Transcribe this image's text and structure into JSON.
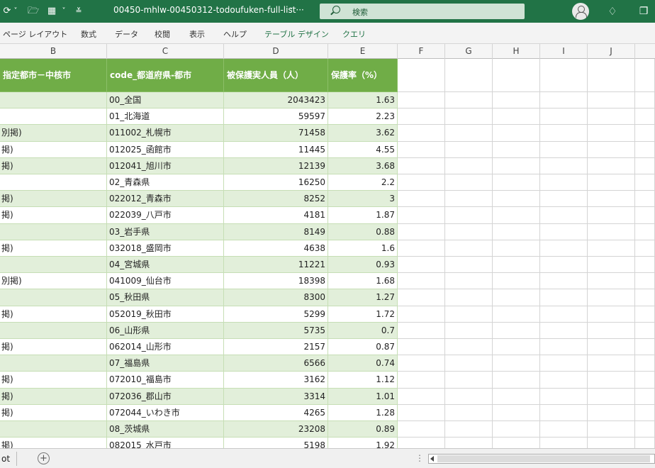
{
  "titlebar": {
    "refresh_glyph": "⟳",
    "refresh_chevron": "˅",
    "folder_glyph": "🗁",
    "form_glyph": "▦",
    "form_chevron": "˅",
    "qa_glyph": "≚",
    "document_title": "00450-mhlw-00450312-todoufuken-full-list···",
    "title_chevron": "˅",
    "search_placeholder": "検索",
    "premium_glyph": "♢",
    "restore_glyph": "❐"
  },
  "ribbon": {
    "tabs": [
      "ページ レイアウト",
      "数式",
      "データ",
      "校閲",
      "表示",
      "ヘルプ",
      "テーブル デザイン",
      "クエリ"
    ]
  },
  "column_headers": [
    "B",
    "C",
    "D",
    "E",
    "F",
    "G",
    "H",
    "I",
    "J"
  ],
  "table": {
    "headers": [
      "指定都市－中核市",
      "code_都道府県-都市",
      "被保護実人員（人）",
      "保護率（%）"
    ],
    "rows": [
      {
        "b": "",
        "c": "00_全国",
        "d": "2043423",
        "e": "1.63"
      },
      {
        "b": "",
        "c": "01_北海道",
        "d": "59597",
        "e": "2.23"
      },
      {
        "b": "別掲)",
        "c": "011002_札幌市",
        "d": "71458",
        "e": "3.62"
      },
      {
        "b": "掲)",
        "c": "012025_函館市",
        "d": "11445",
        "e": "4.55"
      },
      {
        "b": "掲)",
        "c": "012041_旭川市",
        "d": "12139",
        "e": "3.68"
      },
      {
        "b": "",
        "c": "02_青森県",
        "d": "16250",
        "e": "2.2"
      },
      {
        "b": "掲)",
        "c": "022012_青森市",
        "d": "8252",
        "e": "3"
      },
      {
        "b": "掲)",
        "c": "022039_八戸市",
        "d": "4181",
        "e": "1.87"
      },
      {
        "b": "",
        "c": "03_岩手県",
        "d": "8149",
        "e": "0.88"
      },
      {
        "b": "掲)",
        "c": "032018_盛岡市",
        "d": "4638",
        "e": "1.6"
      },
      {
        "b": "",
        "c": "04_宮城県",
        "d": "11221",
        "e": "0.93"
      },
      {
        "b": "別掲)",
        "c": "041009_仙台市",
        "d": "18398",
        "e": "1.68"
      },
      {
        "b": "",
        "c": "05_秋田県",
        "d": "8300",
        "e": "1.27"
      },
      {
        "b": "掲)",
        "c": "052019_秋田市",
        "d": "5299",
        "e": "1.72"
      },
      {
        "b": "",
        "c": "06_山形県",
        "d": "5735",
        "e": "0.7"
      },
      {
        "b": "掲)",
        "c": "062014_山形市",
        "d": "2157",
        "e": "0.87"
      },
      {
        "b": "",
        "c": "07_福島県",
        "d": "6566",
        "e": "0.74"
      },
      {
        "b": "掲)",
        "c": "072010_福島市",
        "d": "3162",
        "e": "1.12"
      },
      {
        "b": "掲)",
        "c": "072036_郡山市",
        "d": "3314",
        "e": "1.01"
      },
      {
        "b": "掲)",
        "c": "072044_いわき市",
        "d": "4265",
        "e": "1.28"
      },
      {
        "b": "",
        "c": "08_茨城県",
        "d": "23208",
        "e": "0.89"
      },
      {
        "b": "掲)",
        "c": "082015_水戸市",
        "d": "5198",
        "e": "1.92"
      }
    ]
  },
  "sheetbar": {
    "sheet_tab": "ot",
    "add_sheet": "+",
    "dots": "⋮"
  },
  "colors": {
    "titlebar": "#217346",
    "table_header": "#70ad47",
    "band": "#e2efda"
  }
}
